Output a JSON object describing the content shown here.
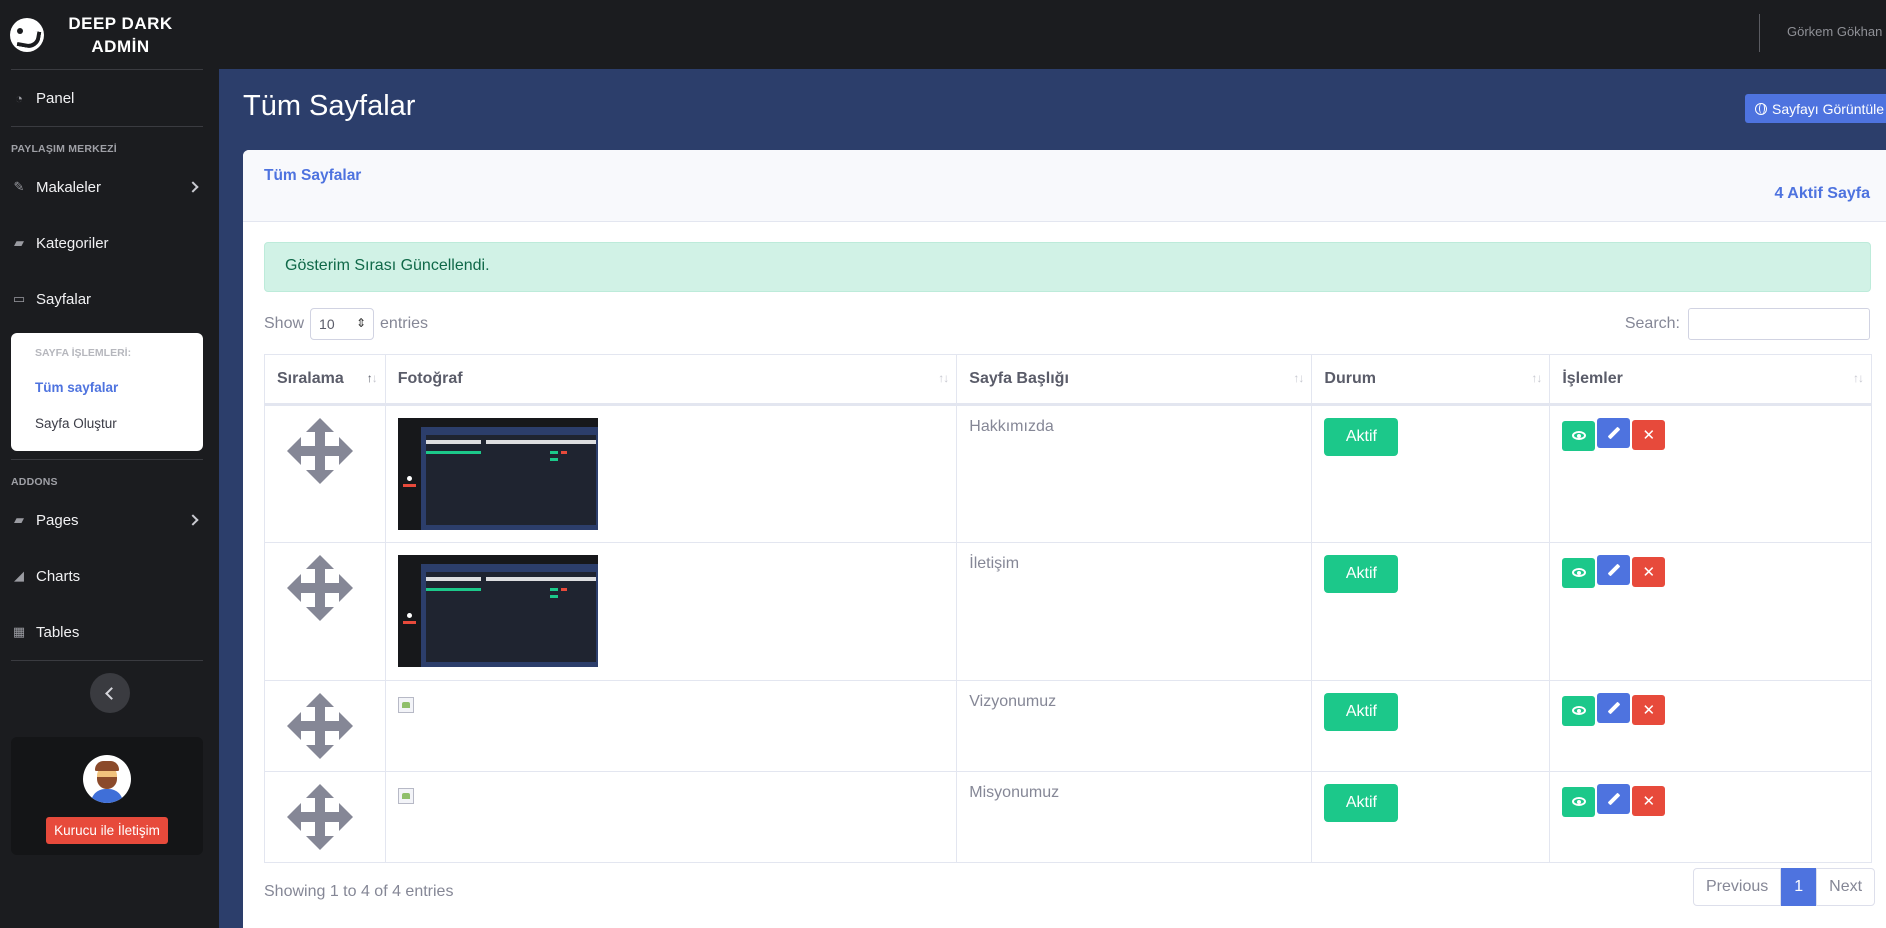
{
  "brand": {
    "line1": "DEEP DARK",
    "line2": "ADMİN"
  },
  "user": {
    "name": "Görkem Gökhan"
  },
  "sidebar": {
    "panel": "Panel",
    "heading1": "PAYLAŞIM MERKEZİ",
    "items": [
      "Makaleler",
      "Kategoriler",
      "Sayfalar"
    ],
    "sub_heading": "SAYFA İŞLEMLERİ:",
    "sub_items": [
      "Tüm sayfalar",
      "Sayfa Oluştur"
    ],
    "heading2": "ADDONS",
    "addons": [
      "Pages",
      "Charts",
      "Tables"
    ],
    "contact_button": "Kurucu ile İletişim"
  },
  "page": {
    "title": "Tüm Sayfalar",
    "view_button": "Sayfayı Görüntüle"
  },
  "card": {
    "title": "Tüm Sayfalar",
    "count_label": "4 Aktif Sayfa",
    "alert": "Gösterim Sırası Güncellendi."
  },
  "table": {
    "show_label": "Show",
    "length_value": "10",
    "entries_label": "entries",
    "search_label": "Search:",
    "columns": [
      "Sıralama",
      "Fotoğraf",
      "Sayfa Başlığı",
      "Durum",
      "İşlemler"
    ],
    "rows": [
      {
        "title": "Hakkımızda",
        "status": "Aktif",
        "photo": "thumbnail"
      },
      {
        "title": "İletişim",
        "status": "Aktif",
        "photo": "thumbnail"
      },
      {
        "title": "Vizyonumuz",
        "status": "Aktif",
        "photo": "broken"
      },
      {
        "title": "Misyonumuz",
        "status": "Aktif",
        "photo": "broken"
      }
    ],
    "info": "Showing 1 to 4 of 4 entries",
    "pager": {
      "prev": "Previous",
      "current": "1",
      "next": "Next"
    }
  },
  "colors": {
    "primary": "#4e73df",
    "success": "#1cc88a",
    "danger": "#e74a3b",
    "sidebar_bg": "#1b1c1f",
    "main_bg": "#2c3e6b"
  }
}
